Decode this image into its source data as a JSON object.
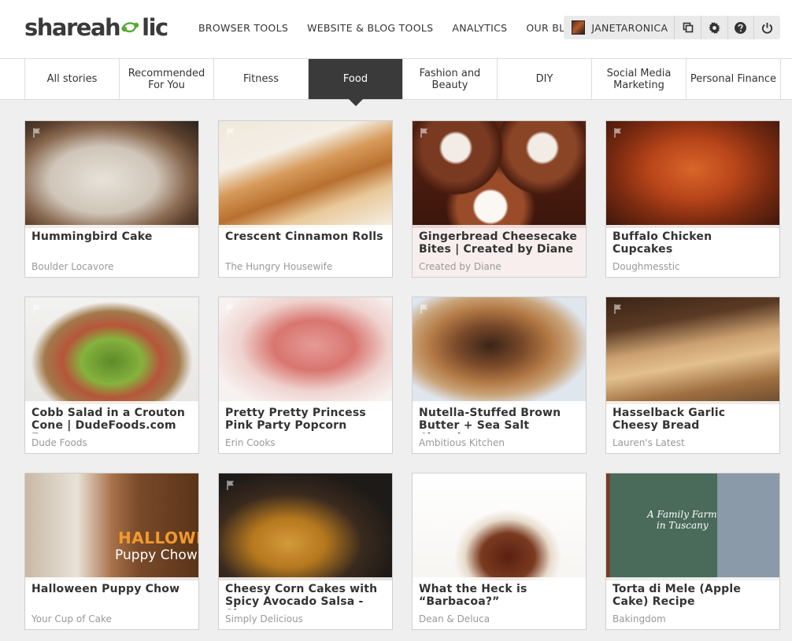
{
  "brand": {
    "logo_text_left": "shareah",
    "logo_text_right": "lic",
    "logo_glyph_color": "#56a832"
  },
  "nav": {
    "items": [
      {
        "label": "BROWSER TOOLS"
      },
      {
        "label": "WEBSITE & BLOG TOOLS"
      },
      {
        "label": "ANALYTICS"
      },
      {
        "label": "OUR BLOG"
      }
    ]
  },
  "user": {
    "name": "JANETARONICA",
    "buttons": [
      {
        "icon": "copy-icon"
      },
      {
        "icon": "gear-icon"
      },
      {
        "icon": "help-icon"
      },
      {
        "icon": "power-icon"
      }
    ]
  },
  "tabs": [
    {
      "label": "All stories",
      "active": false
    },
    {
      "label": "Recommended For You",
      "active": false
    },
    {
      "label": "Fitness",
      "active": false
    },
    {
      "label": "Food",
      "active": true
    },
    {
      "label": "Fashion and Beauty",
      "active": false
    },
    {
      "label": "DIY",
      "active": false
    },
    {
      "label": "Social Media Marketing",
      "active": false
    },
    {
      "label": "Personal Finance",
      "active": false
    }
  ],
  "accent_color": "#3a3a3a",
  "cards": [
    {
      "title": "Hummingbird Cake",
      "source": "Boulder Locavore",
      "img": "cake"
    },
    {
      "title": "Crescent Cinnamon Rolls",
      "source": "The Hungry Housewife",
      "img": "rolls"
    },
    {
      "title": "Gingerbread Cheesecake Bites | Created by Diane",
      "source": "Created by Diane",
      "img": "cheesecake"
    },
    {
      "title": "Buffalo Chicken Cupcakes",
      "source": "Doughmesstic",
      "img": "buffalo"
    },
    {
      "title": "Cobb Salad in a Crouton Cone | DudeFoods.com Fo...",
      "source": "Dude Foods",
      "img": "salad"
    },
    {
      "title": "Pretty Pretty Princess Pink Party Popcorn",
      "source": "Erin Cooks",
      "img": "popcorn"
    },
    {
      "title": "Nutella-Stuffed Brown Butter + Sea Salt Chocola...",
      "source": "Ambitious Kitchen",
      "img": "cookie"
    },
    {
      "title": "Hasselback Garlic Cheesy Bread",
      "source": "Lauren's Latest",
      "img": "bread"
    },
    {
      "title": "Halloween Puppy Chow",
      "source": "Your Cup of Cake",
      "img": "puppychow",
      "overlay_line1": "HALLOWEEN",
      "overlay_line2": "Puppy Chow"
    },
    {
      "title": "Cheesy Corn Cakes with Spicy Avocado Salsa - Si...",
      "source": "Simply Delicious",
      "img": "corncakes"
    },
    {
      "title": "What the Heck is “Barbacoa?”",
      "source": "Dean & Deluca",
      "img": "ribs"
    },
    {
      "title": "Torta di Mele (Apple Cake) Recipe",
      "source": "Bakingdom",
      "img": "tuscany",
      "overlay_line1": "A Family Farm",
      "overlay_line2": "in Tuscany"
    }
  ]
}
